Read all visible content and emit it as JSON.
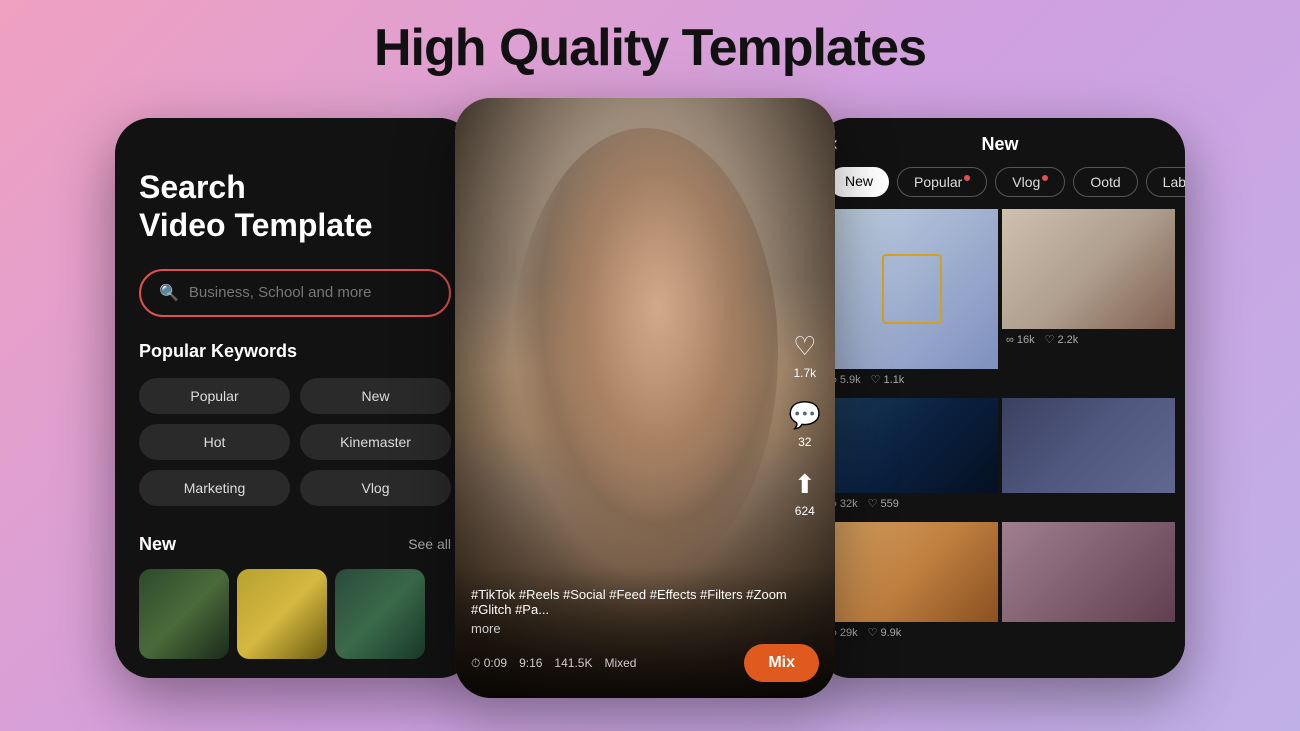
{
  "page": {
    "title": "High Quality Templates"
  },
  "phone1": {
    "search_title": "Search\nVideo Template",
    "search_placeholder": "Business, School and more",
    "keywords_title": "Popular Keywords",
    "keywords": [
      "Popular",
      "New",
      "Hot",
      "Kinemaster",
      "Marketing",
      "Vlog"
    ],
    "new_section_title": "New",
    "see_all_label": "See all"
  },
  "phone2": {
    "heart_count": "1.7k",
    "comment_count": "32",
    "share_count": "624",
    "tags": "#TikTok #Reels #Social #Feed #Effects #Filters #Zoom #Glitch #Pa...",
    "more_label": "more",
    "duration": "0:09",
    "resolution": "9:16",
    "views": "141.5K",
    "type": "Mixed",
    "mix_button_label": "Mix"
  },
  "phone3": {
    "header_title": "New",
    "back_icon": "‹",
    "tabs": [
      {
        "label": "New",
        "active": true,
        "dot": false
      },
      {
        "label": "Popular",
        "active": false,
        "dot": true
      },
      {
        "label": "Vlog",
        "active": false,
        "dot": true
      },
      {
        "label": "Ootd",
        "active": false,
        "dot": false
      },
      {
        "label": "Lab",
        "active": false,
        "dot": false
      }
    ],
    "grid_items": [
      {
        "views": "5.9k",
        "likes": "1.1k"
      },
      {
        "views": "16k",
        "likes": "2.2k"
      },
      {
        "views": "32k",
        "likes": "559"
      },
      {
        "views": "",
        "likes": ""
      },
      {
        "views": "29k",
        "likes": "9.9k"
      },
      {
        "views": "",
        "likes": ""
      }
    ]
  }
}
